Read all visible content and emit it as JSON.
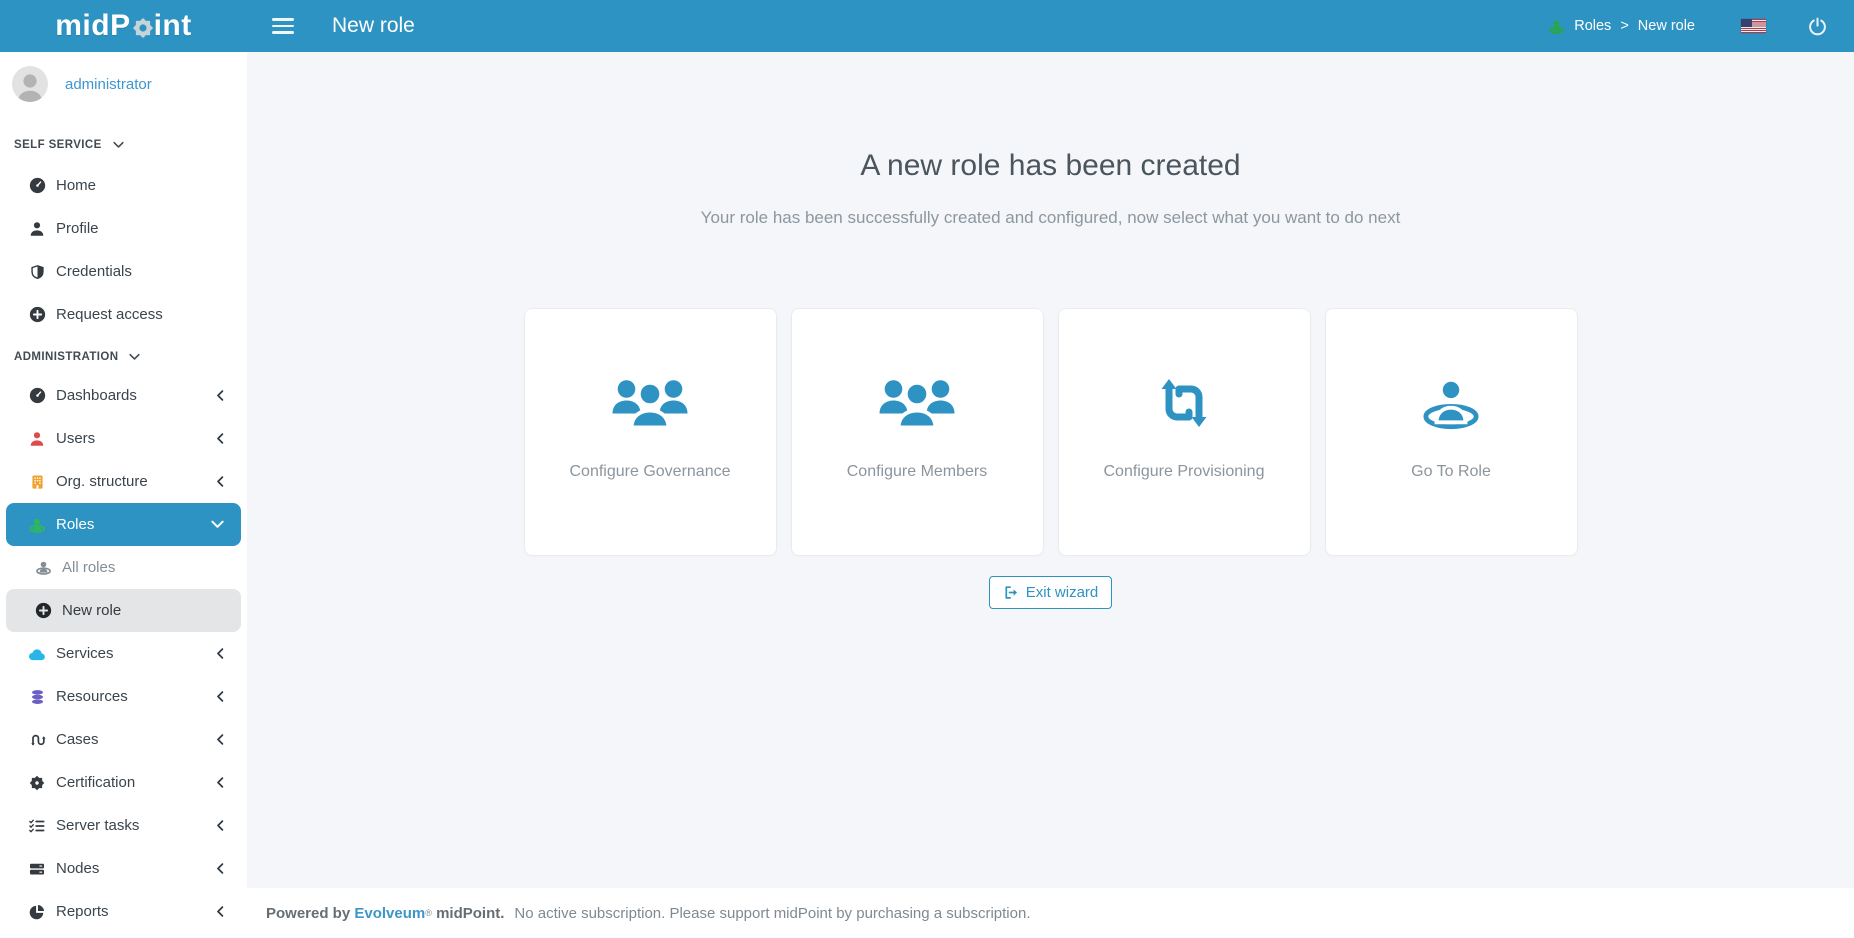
{
  "header": {
    "logo_pre": "midP",
    "logo_post": "int",
    "title": "New role",
    "breadcrumb": {
      "items": [
        "Roles",
        "New role"
      ],
      "separator": ">"
    }
  },
  "sidebar": {
    "user": {
      "name": "administrator"
    },
    "sections": [
      {
        "label": "SELF SERVICE",
        "items": [
          {
            "label": "Home",
            "icon": "dashboard-icon"
          },
          {
            "label": "Profile",
            "icon": "user-icon"
          },
          {
            "label": "Credentials",
            "icon": "shield-icon"
          },
          {
            "label": "Request access",
            "icon": "plus-circle-icon"
          }
        ]
      },
      {
        "label": "ADMINISTRATION",
        "items": [
          {
            "label": "Dashboards",
            "icon": "dashboard-icon",
            "expandable": true
          },
          {
            "label": "Users",
            "icon": "user-icon",
            "expandable": true
          },
          {
            "label": "Org. structure",
            "icon": "building-icon",
            "expandable": true
          },
          {
            "label": "Roles",
            "icon": "role-icon",
            "expandable": true,
            "state": "expanded-active"
          },
          {
            "label": "All roles",
            "icon": "role-icon",
            "sub_item": true
          },
          {
            "label": "New role",
            "icon": "plus-circle-icon",
            "sub_item": true,
            "state": "selected"
          },
          {
            "label": "Services",
            "icon": "cloud-icon",
            "expandable": true
          },
          {
            "label": "Resources",
            "icon": "database-icon",
            "expandable": true
          },
          {
            "label": "Cases",
            "icon": "case-flow-icon",
            "expandable": true
          },
          {
            "label": "Certification",
            "icon": "seal-icon",
            "expandable": true
          },
          {
            "label": "Server tasks",
            "icon": "task-list-icon",
            "expandable": true
          },
          {
            "label": "Nodes",
            "icon": "server-icon",
            "expandable": true
          },
          {
            "label": "Reports",
            "icon": "pie-chart-icon",
            "expandable": true
          }
        ]
      }
    ]
  },
  "main": {
    "title": "A new role has been created",
    "subtitle": "Your role has been successfully created and configured, now select what you want to do next",
    "cards": [
      {
        "label": "Configure Governance",
        "icon": "users-group-icon"
      },
      {
        "label": "Configure Members",
        "icon": "users-group-icon"
      },
      {
        "label": "Configure Provisioning",
        "icon": "retweet-icon"
      },
      {
        "label": "Go To Role",
        "icon": "role-icon"
      }
    ],
    "exit_button": {
      "label": "Exit wizard",
      "icon": "sign-out-icon"
    }
  },
  "footer": {
    "powered_by": "Powered by",
    "brand": "Evolveum",
    "registered": "®",
    "product": "midPoint.",
    "message": "No active subscription. Please support midPoint by purchasing a subscription."
  },
  "colors": {
    "header_blue": "#2d93c2",
    "content_bg": "#f4f6f9",
    "active_item_blue": "#2d93c2",
    "selected_item_gray": "#e4e5e6",
    "card_icon_blue": "#2e93c3",
    "link_blue": "#3d96c8",
    "users_red": "#dd4b4b",
    "org_orange": "#f0a22e",
    "roles_green": "#28a745",
    "services_cyan": "#29b6e6",
    "resources_purple": "#6a5fc3",
    "dark_icon": "#343a40"
  }
}
